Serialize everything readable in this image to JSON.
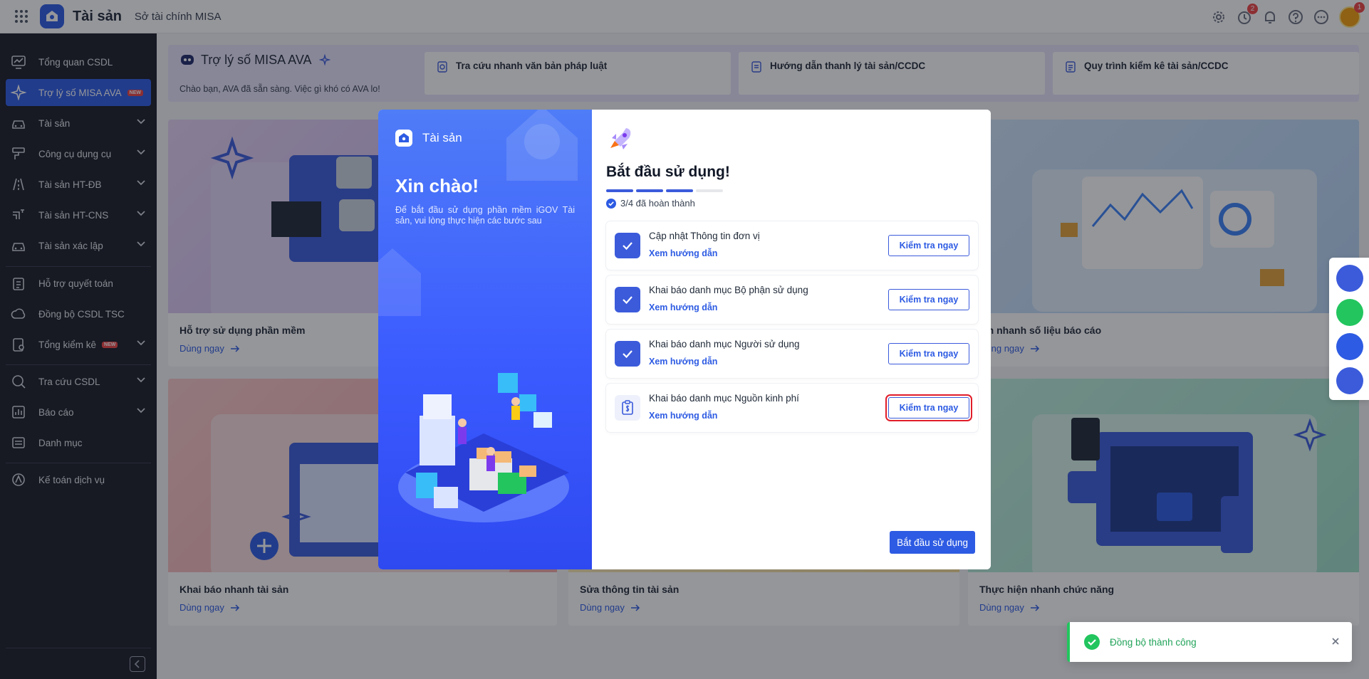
{
  "header": {
    "app_name": "Tài sản",
    "org_name": "Sở tài chính MISA",
    "badges": {
      "reminders": "2",
      "avatar": "1"
    },
    "icons": [
      "apps-grid-icon",
      "settings-icon",
      "alarm-clock-icon",
      "bell-icon",
      "help-icon",
      "more-icon"
    ]
  },
  "sidebar": {
    "items": [
      {
        "label": "Tổng quan CSDL",
        "icon": "chart-line-icon"
      },
      {
        "label": "Trợ lý số MISA AVA",
        "icon": "sparkle-icon",
        "badge": "NEW"
      },
      {
        "label": "Tài sản",
        "icon": "car-icon"
      },
      {
        "label": "Công cụ dụng cụ",
        "icon": "brush-icon"
      },
      {
        "label": "Tài sản HT-ĐB",
        "icon": "road-icon"
      },
      {
        "label": "Tài sản HT-CNS",
        "icon": "pipe-icon"
      },
      {
        "label": "Tài sản xác lập",
        "icon": "car-icon"
      },
      {
        "label": "Hỗ trợ quyết toán",
        "icon": "clipboard-icon"
      },
      {
        "label": "Đồng bộ CSDL TSC",
        "icon": "cloud-sync-icon"
      },
      {
        "label": "Tổng kiểm kê",
        "icon": "inventory-icon",
        "badge": "NEW"
      },
      {
        "label": "Tra cứu CSDL",
        "icon": "search-icon"
      },
      {
        "label": "Báo cáo",
        "icon": "bar-chart-icon"
      },
      {
        "label": "Danh mục",
        "icon": "list-icon"
      },
      {
        "label": "Kế toán dịch vụ",
        "icon": "service-icon"
      }
    ]
  },
  "ava": {
    "title": "Trợ lý số MISA AVA",
    "subtitle": "Chào bạn, AVA đã sẵn sàng. Việc gì khó có AVA lo!",
    "cards": [
      "Tra cứu nhanh văn bản pháp luật",
      "Hướng dẫn thanh lý tài sản/CCDC",
      "Quy trình kiểm kê tài sản/CCDC"
    ]
  },
  "cards": [
    {
      "title": "Hỗ trợ sử dụng phần mềm",
      "action": "Dùng ngay"
    },
    {
      "title": "em nhanh số liệu báo cáo",
      "action": "Dùng ngay"
    },
    {
      "title": "Khai báo nhanh tài sản",
      "action": "Dùng ngay"
    },
    {
      "title": "Sửa thông tin tài sản",
      "action": "Dùng ngay"
    },
    {
      "title": "Thực hiện nhanh chức năng",
      "action": "Dùng ngay"
    }
  ],
  "modal": {
    "brand": "Tài sản",
    "hello": "Xin chào!",
    "desc": "Để bắt đầu sử dụng phần mềm iGOV Tài sản, vui lòng thực hiện các bước sau",
    "title": "Bắt đầu sử dụng!",
    "progress": {
      "done": 3,
      "total": 4,
      "text": "3/4 đã hoàn thành"
    },
    "steps": [
      {
        "name": "Cập nhật Thông tin đơn vị",
        "guide": "Xem hướng dẫn",
        "button": "Kiểm tra ngay",
        "done": true
      },
      {
        "name": "Khai báo danh mục Bộ phận sử dụng",
        "guide": "Xem hướng dẫn",
        "button": "Kiểm tra ngay",
        "done": true
      },
      {
        "name": "Khai báo danh mục Người sử dụng",
        "guide": "Xem hướng dẫn",
        "button": "Kiểm tra ngay",
        "done": true
      },
      {
        "name": "Khai báo danh mục Nguồn kinh phí",
        "guide": "Xem hướng dẫn",
        "button": "Kiểm tra ngay",
        "done": false
      }
    ],
    "start_button": "Bắt đầu sử dụng"
  },
  "toast": {
    "message": "Đồng bộ thành công"
  },
  "colors": {
    "primary": "#2d5be3",
    "sidebar_bg": "#1a1d27",
    "success": "#22c55e",
    "highlight": "#e11d2a"
  }
}
